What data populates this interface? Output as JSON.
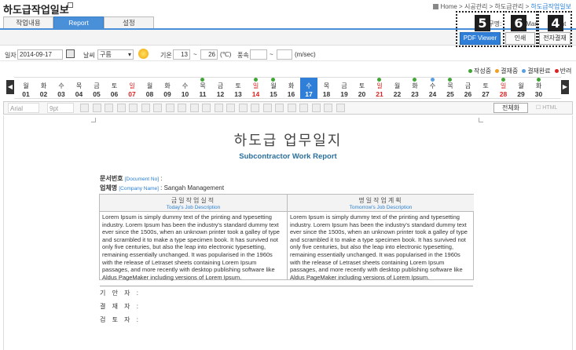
{
  "header": {
    "title": "하도급작업일보",
    "breadcrumb": {
      "home": "Home",
      "sep1": " > ",
      "c1": "시공관리",
      "sep2": " > ",
      "c2": "하도급관리",
      "sep3": " > ",
      "current": "하도급작업일보"
    }
  },
  "tabs": [
    {
      "label": "작업내용"
    },
    {
      "label": "Report"
    },
    {
      "label": "설정"
    }
  ],
  "toolbar": {
    "approval_text": "업무명: ",
    "approval_text2": "h Man",
    "approval_text3": "nent",
    "pdf_label": "PDF Viewer",
    "print_label": "인쇄",
    "esign_label": "전자결재",
    "callouts": [
      "5",
      "6",
      "4"
    ]
  },
  "form": {
    "date_label": "일자",
    "date_value": "2014-09-17",
    "weather_label": "날씨",
    "weather_value": "구름",
    "temp_label": "기온",
    "temp_min": "13",
    "tilde1": "~",
    "temp_max": "26",
    "temp_unit": "(℃)",
    "wind_label": "풍속",
    "wind_min": "",
    "tilde2": "~",
    "wind_max": "",
    "wind_unit": "(m/sec)"
  },
  "legend": [
    {
      "label": "작성중",
      "color": "#3fa535"
    },
    {
      "label": "결재중",
      "color": "#f0a020"
    },
    {
      "label": "결재완료",
      "color": "#5a9fe0"
    },
    {
      "label": "반려",
      "color": "#e02020"
    }
  ],
  "calendar": {
    "days": [
      {
        "dow": "월",
        "num": "01",
        "sun": false
      },
      {
        "dow": "화",
        "num": "02",
        "sun": false
      },
      {
        "dow": "수",
        "num": "03",
        "sun": false
      },
      {
        "dow": "목",
        "num": "04",
        "sun": false
      },
      {
        "dow": "금",
        "num": "05",
        "sun": false
      },
      {
        "dow": "토",
        "num": "06",
        "sun": false
      },
      {
        "dow": "일",
        "num": "07",
        "sun": true
      },
      {
        "dow": "월",
        "num": "08",
        "sun": false
      },
      {
        "dow": "화",
        "num": "09",
        "sun": false
      },
      {
        "dow": "수",
        "num": "10",
        "sun": false
      },
      {
        "dow": "목",
        "num": "11",
        "sun": false,
        "dot": "#3fa535"
      },
      {
        "dow": "금",
        "num": "12",
        "sun": false
      },
      {
        "dow": "토",
        "num": "13",
        "sun": false
      },
      {
        "dow": "일",
        "num": "14",
        "sun": true,
        "dot": "#3fa535"
      },
      {
        "dow": "월",
        "num": "15",
        "sun": false,
        "dot": "#3fa535"
      },
      {
        "dow": "화",
        "num": "16",
        "sun": false
      },
      {
        "dow": "수",
        "num": "17",
        "sun": false,
        "selected": true
      },
      {
        "dow": "목",
        "num": "18",
        "sun": false
      },
      {
        "dow": "금",
        "num": "19",
        "sun": false
      },
      {
        "dow": "토",
        "num": "20",
        "sun": false
      },
      {
        "dow": "일",
        "num": "21",
        "sun": true,
        "dot": "#3fa535"
      },
      {
        "dow": "월",
        "num": "22",
        "sun": false
      },
      {
        "dow": "화",
        "num": "23",
        "sun": false,
        "dot": "#3fa535"
      },
      {
        "dow": "수",
        "num": "24",
        "sun": false,
        "dot": "#5a9fe0"
      },
      {
        "dow": "목",
        "num": "25",
        "sun": false,
        "dot": "#3fa535"
      },
      {
        "dow": "금",
        "num": "26",
        "sun": false
      },
      {
        "dow": "토",
        "num": "27",
        "sun": false
      },
      {
        "dow": "일",
        "num": "28",
        "sun": true,
        "dot": "#3fa535"
      },
      {
        "dow": "월",
        "num": "29",
        "sun": false
      },
      {
        "dow": "화",
        "num": "30",
        "sun": false,
        "dot": "#3fa535"
      }
    ]
  },
  "editor": {
    "font_value": "Arial",
    "size_value": "9pt",
    "full_label": "전체화",
    "html_label": "HTML"
  },
  "document": {
    "title": "하도급 업무일지",
    "subtitle": "Subcontractor Work Report",
    "doc_no_label": "문서번호",
    "doc_no_en": "[Document No]",
    "doc_no_value": " :",
    "company_label": "업체명",
    "company_en": "[Company Name]",
    "company_value": " : Sangah Management",
    "today_ko": "금일작업실적",
    "today_en": "Today's Job Description",
    "tomorrow_ko": "명일작업계획",
    "tomorrow_en": "Tomorrow's Job Description",
    "today_text": "Lorem Ipsum is simply dummy text of the printing and typesetting industry. Lorem Ipsum has been the industry's standard dummy text ever since the 1500s, when an unknown printer took a galley of type and scrambled it to make a type specimen book. It has survived not only five centuries, but also the leap into electronic typesetting, remaining essentially unchanged. It was popularised in the 1960s with the release of Letraset sheets containing Lorem Ipsum passages, and more recently with desktop publishing software like Aldus PageMaker including versions of Lorem Ipsum.",
    "tomorrow_text": "Lorem Ipsum is simply dummy text of the printing and typesetting industry. Lorem Ipsum has been the industry's standard dummy text ever since the 1500s, when an unknown printer took a galley of type and scrambled it to make a type specimen book. It has survived not only five centuries, but also the leap into electronic typesetting, remaining essentially unchanged. It was popularised in the 1960s with the release of Letraset sheets containing Lorem Ipsum passages, and more recently with desktop publishing software like Aldus PageMaker including versions of Lorem Ipsum.",
    "sig1": "기 안 자 :",
    "sig2": "결 재 자 :",
    "sig3": "검 토 자 :"
  }
}
